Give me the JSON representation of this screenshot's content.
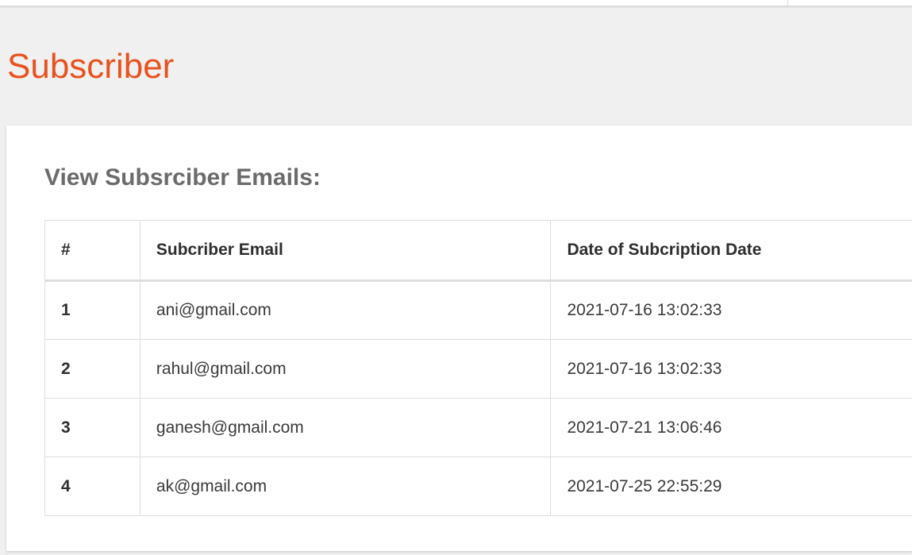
{
  "page": {
    "title": "Subscriber"
  },
  "panel": {
    "heading": "View Subsrciber Emails:"
  },
  "table": {
    "columns": [
      "#",
      "Subcriber Email",
      "Date of Subcription Date"
    ],
    "rows": [
      {
        "index": "1",
        "email": "ani@gmail.com",
        "date": "2021-07-16 13:02:33"
      },
      {
        "index": "2",
        "email": "rahul@gmail.com",
        "date": "2021-07-16 13:02:33"
      },
      {
        "index": "3",
        "email": "ganesh@gmail.com",
        "date": "2021-07-21 13:06:46"
      },
      {
        "index": "4",
        "email": "ak@gmail.com",
        "date": "2021-07-25 22:55:29"
      }
    ]
  },
  "colors": {
    "title": "#e8521f",
    "heading": "#6b6b6b",
    "background": "#f0f0f0",
    "panel": "#ffffff",
    "border": "#dddddd"
  }
}
